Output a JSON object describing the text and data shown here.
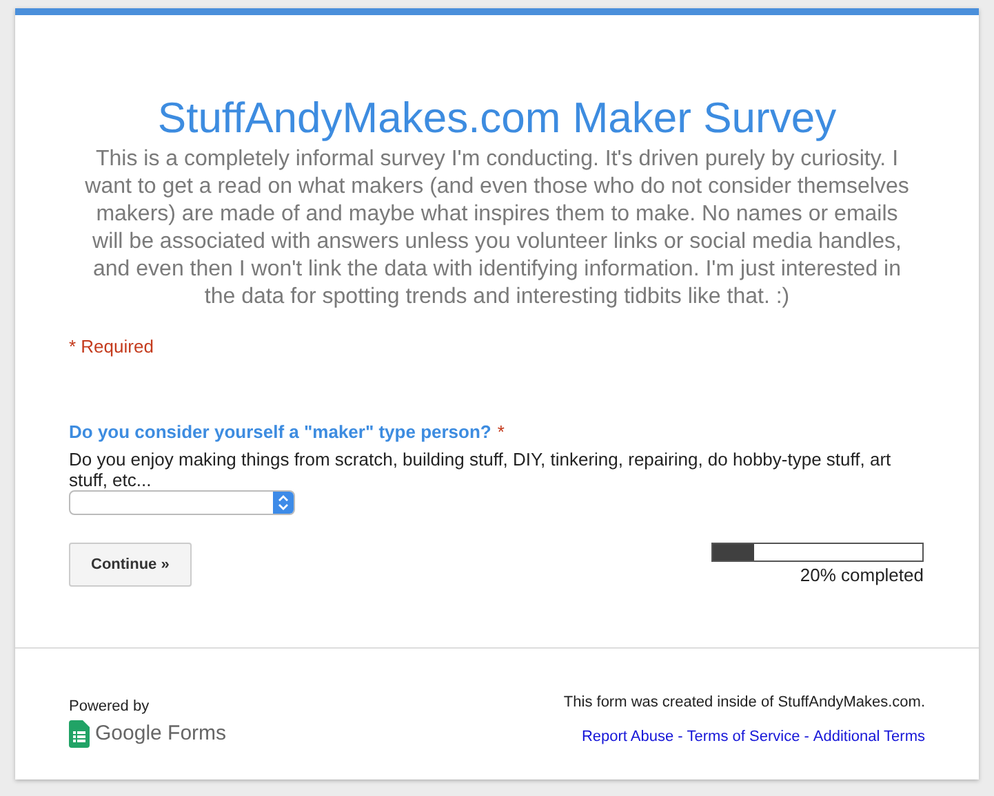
{
  "title": "StuffAndyMakes.com Maker Survey",
  "description": "This is a completely informal survey I'm conducting. It's driven purely by curiosity. I want to get a read on what makers (and even those who do not consider themselves makers) are made of and maybe what inspires them to make. No names or emails will be associated with answers unless you volunteer links or social media handles, and even then I won't link the data with identifying information. I'm just interested in the data for spotting trends and interesting tidbits like that. :)",
  "required_note": "* Required",
  "question": {
    "title": "Do you consider yourself a \"maker\" type person?",
    "required_mark": "*",
    "help": "Do you enjoy making things from scratch, building stuff, DIY, tinkering, repairing, do hobby-type stuff, art stuff, etc..."
  },
  "continue_button": "Continue »",
  "progress": {
    "level": 0.2,
    "label": "20% completed"
  },
  "footer": {
    "powered_by": "Powered by",
    "brand": "Google Forms",
    "created_note": "This form was created inside of StuffAndyMakes.com.",
    "links": [
      {
        "kind": "link",
        "label": "Report Abuse"
      },
      {
        "kind": "separator",
        "label": "-"
      },
      {
        "kind": "link",
        "label": "Terms of Service"
      },
      {
        "kind": "separator",
        "label": "-"
      },
      {
        "kind": "link",
        "label": "Additional Terms"
      }
    ]
  }
}
